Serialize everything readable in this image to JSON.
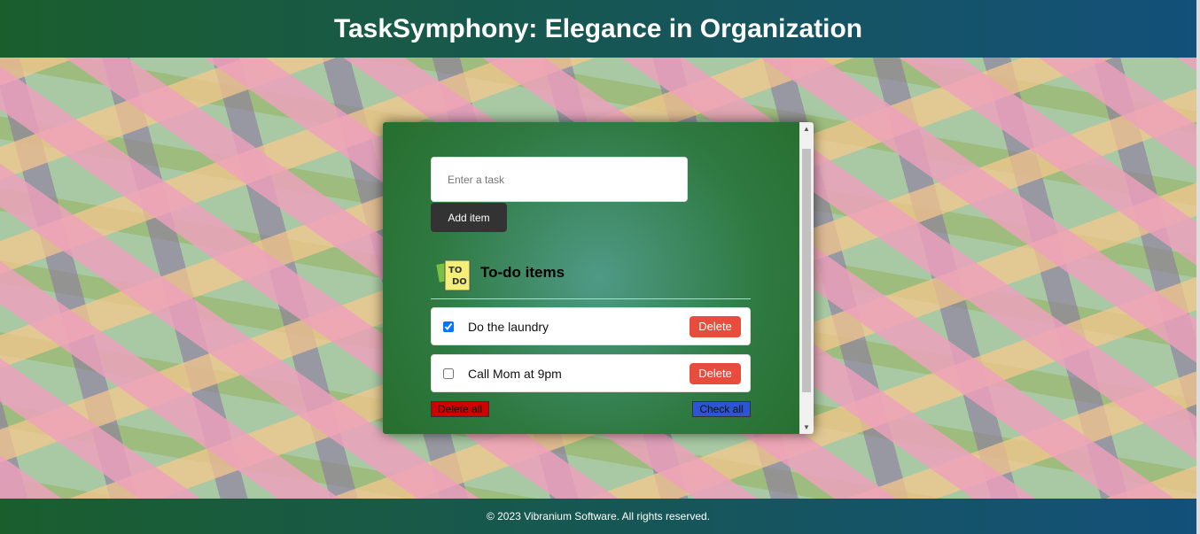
{
  "header": {
    "title": "TaskSymphony: Elegance in Organization"
  },
  "form": {
    "placeholder": "Enter a task",
    "add_label": "Add item"
  },
  "list": {
    "heading": "To-do items",
    "icon": "todo-note-icon",
    "items": [
      {
        "text": "Do the laundry",
        "checked": true,
        "delete_label": "Delete"
      },
      {
        "text": "Call Mom at 9pm",
        "checked": false,
        "delete_label": "Delete"
      }
    ],
    "delete_all_label": "Delete all",
    "check_all_label": "Check all"
  },
  "footer": {
    "text": "© 2023 Vibranium Software. All rights reserved."
  },
  "colors": {
    "delete": "#e74c3c",
    "delete_all": "#d10000",
    "check_all": "#2b55d1"
  }
}
